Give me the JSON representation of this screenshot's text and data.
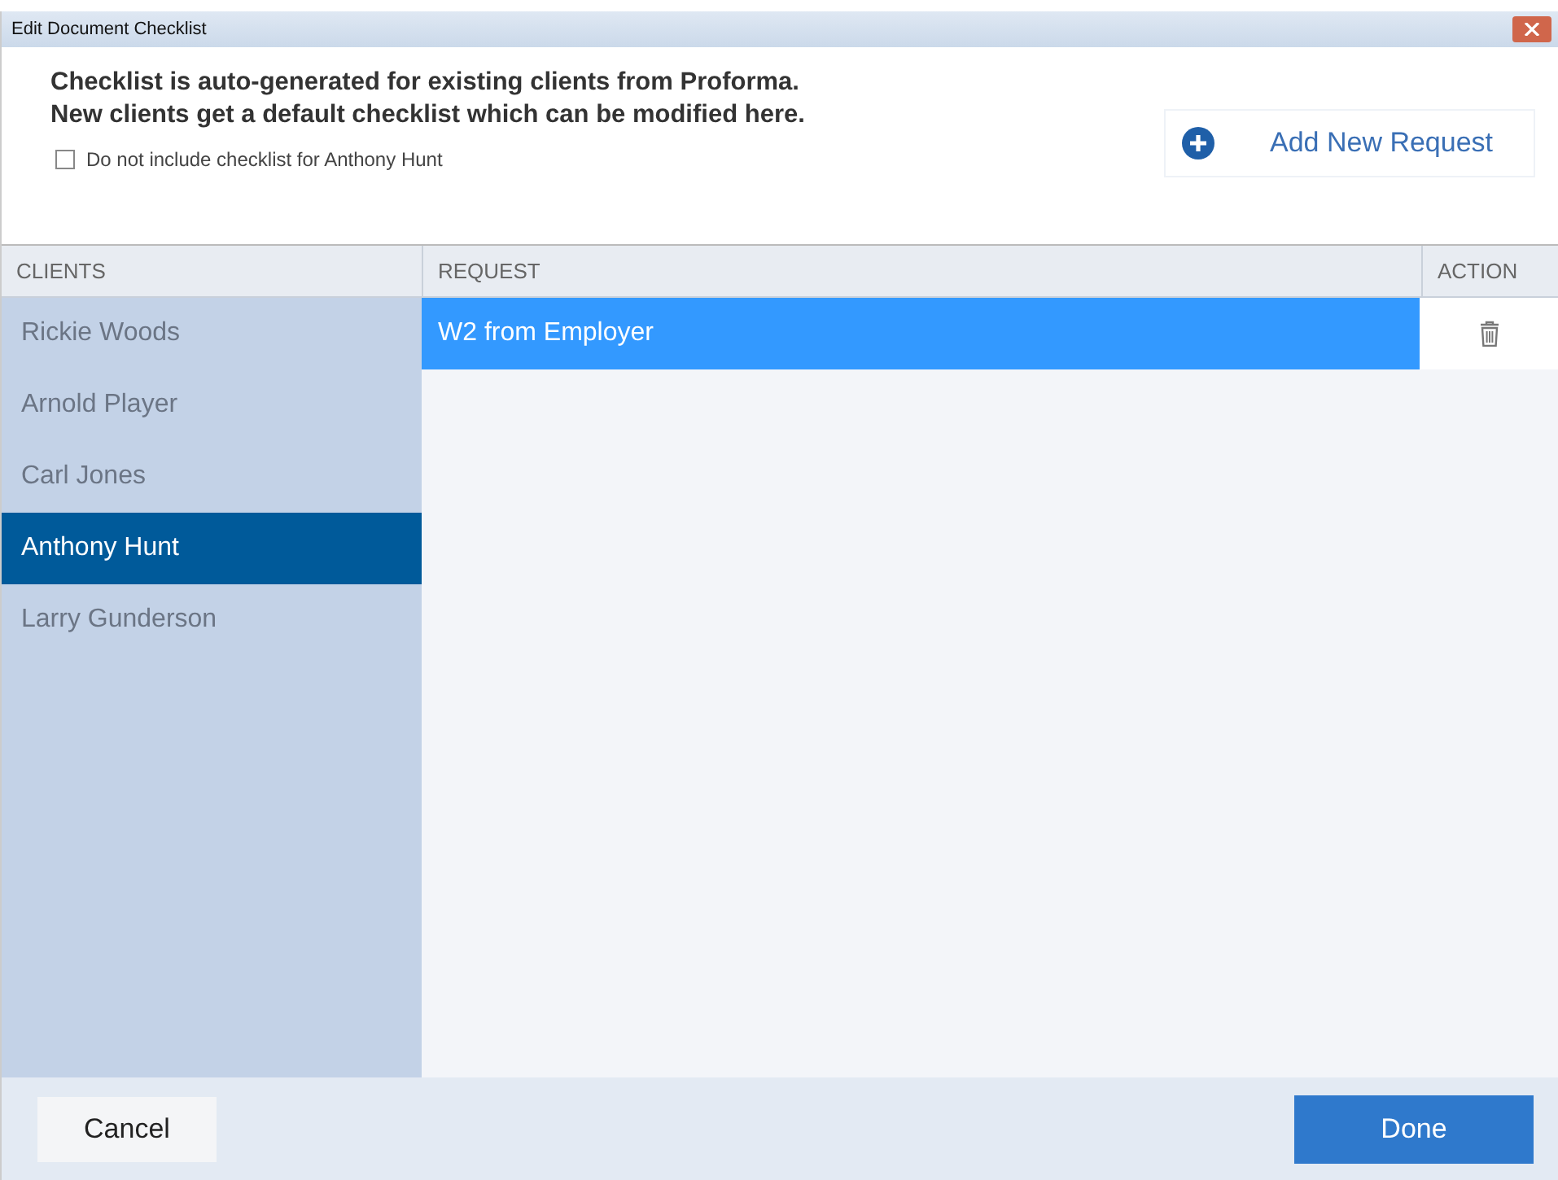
{
  "window": {
    "title": "Edit Document Checklist"
  },
  "intro": [
    "Checklist is auto-generated for existing clients from Proforma.",
    "New clients get a default checklist which can be modified here."
  ],
  "exclude_checkbox": {
    "label": "Do not include checklist for Anthony Hunt",
    "checked": false
  },
  "add_button": {
    "label": "Add New Request"
  },
  "clients": {
    "heading": "CLIENTS",
    "items": [
      {
        "name": "Rickie Woods",
        "selected": false
      },
      {
        "name": "Arnold Player",
        "selected": false
      },
      {
        "name": "Carl Jones",
        "selected": false
      },
      {
        "name": "Anthony Hunt",
        "selected": true
      },
      {
        "name": "Larry Gunderson",
        "selected": false
      }
    ]
  },
  "requests": {
    "columns": [
      "REQUEST",
      "ACTION"
    ],
    "rows": [
      {
        "request": "W2 from Employer",
        "selected": true
      }
    ]
  },
  "buttons": {
    "cancel": "Cancel",
    "done": "Done"
  }
}
